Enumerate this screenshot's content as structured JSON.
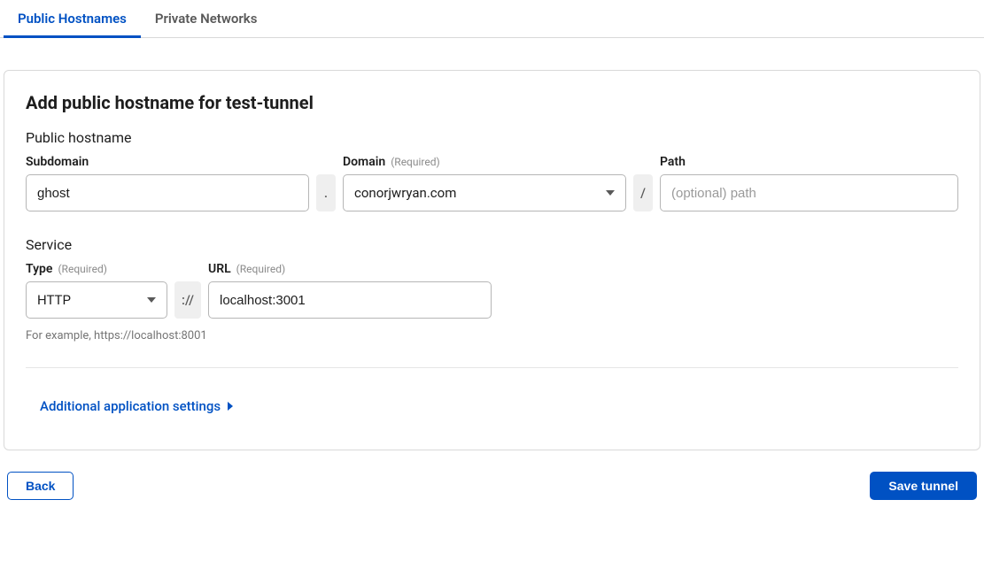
{
  "tabs": {
    "public": "Public Hostnames",
    "private": "Private Networks"
  },
  "card": {
    "title": "Add public hostname for test-tunnel",
    "hostname_section": "Public hostname",
    "subdomain_label": "Subdomain",
    "subdomain_value": "ghost",
    "dot": ".",
    "domain_label": "Domain",
    "domain_required": "(Required)",
    "domain_value": "conorjwryan.com",
    "slash": "/",
    "path_label": "Path",
    "path_placeholder": "(optional) path",
    "service_section": "Service",
    "type_label": "Type",
    "type_required": "(Required)",
    "type_value": "HTTP",
    "protocol_sep": "://",
    "url_label": "URL",
    "url_required": "(Required)",
    "url_value": "localhost:3001",
    "hint": "For example, https://localhost:8001",
    "expand": "Additional application settings"
  },
  "footer": {
    "back": "Back",
    "save": "Save tunnel"
  }
}
